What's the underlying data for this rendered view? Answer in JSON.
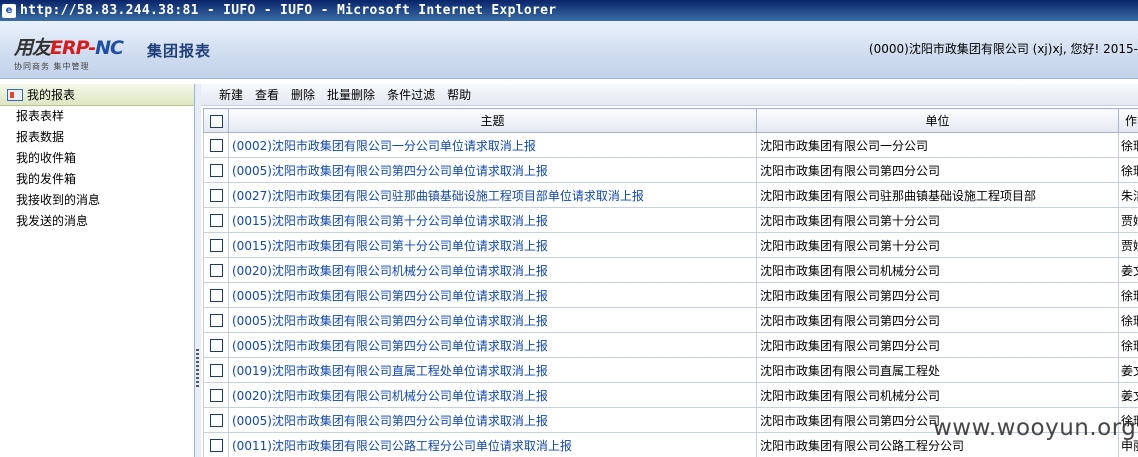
{
  "window": {
    "title": "http://58.83.244.38:81 - IUFO - IUFO - Microsoft Internet Explorer"
  },
  "header": {
    "logo_brand_1": "用友",
    "logo_brand_erp": "ERP-",
    "logo_brand_nc": "NC",
    "logo_sub": "协同商务 集中管理",
    "module_title": "集团报表",
    "user_info": "(0000)沈阳市政集团有限公司  (xj)xj, 您好! 2015-"
  },
  "sidebar": {
    "title": "我的报表",
    "items": [
      {
        "label": "报表表样"
      },
      {
        "label": "报表数据"
      },
      {
        "label": "我的收件箱"
      },
      {
        "label": "我的发件箱"
      },
      {
        "label": "我接收到的消息"
      },
      {
        "label": "我发送的消息"
      }
    ]
  },
  "toolbar": {
    "buttons": [
      {
        "label": "新建"
      },
      {
        "label": "查看"
      },
      {
        "label": "删除"
      },
      {
        "label": "批量删除"
      },
      {
        "label": "条件过滤"
      },
      {
        "label": "帮助"
      }
    ]
  },
  "table": {
    "columns": [
      "主题",
      "单位",
      "作"
    ],
    "rows": [
      {
        "subject": "(0002)沈阳市政集团有限公司一分公司单位请求取消上报",
        "unit": "沈阳市政集团有限公司一分公司",
        "author": "徐瑕"
      },
      {
        "subject": "(0005)沈阳市政集团有限公司第四分公司单位请求取消上报",
        "unit": "沈阳市政集团有限公司第四分公司",
        "author": "徐瑕"
      },
      {
        "subject": "(0027)沈阳市政集团有限公司驻那曲镇基础设施工程项目部单位请求取消上报",
        "unit": "沈阳市政集团有限公司驻那曲镇基础设施工程项目部",
        "author": "朱洁"
      },
      {
        "subject": "(0015)沈阳市政集团有限公司第十分公司单位请求取消上报",
        "unit": "沈阳市政集团有限公司第十分公司",
        "author": "贾姣"
      },
      {
        "subject": "(0015)沈阳市政集团有限公司第十分公司单位请求取消上报",
        "unit": "沈阳市政集团有限公司第十分公司",
        "author": "贾姣"
      },
      {
        "subject": "(0020)沈阳市政集团有限公司机械分公司单位请求取消上报",
        "unit": "沈阳市政集团有限公司机械分公司",
        "author": "姜文"
      },
      {
        "subject": "(0005)沈阳市政集团有限公司第四分公司单位请求取消上报",
        "unit": "沈阳市政集团有限公司第四分公司",
        "author": "徐瑕"
      },
      {
        "subject": "(0005)沈阳市政集团有限公司第四分公司单位请求取消上报",
        "unit": "沈阳市政集团有限公司第四分公司",
        "author": "徐瑕"
      },
      {
        "subject": "(0005)沈阳市政集团有限公司第四分公司单位请求取消上报",
        "unit": "沈阳市政集团有限公司第四分公司",
        "author": "徐瑕"
      },
      {
        "subject": "(0019)沈阳市政集团有限公司直属工程处单位请求取消上报",
        "unit": "沈阳市政集团有限公司直属工程处",
        "author": "姜文"
      },
      {
        "subject": "(0020)沈阳市政集团有限公司机械分公司单位请求取消上报",
        "unit": "沈阳市政集团有限公司机械分公司",
        "author": "姜文"
      },
      {
        "subject": "(0005)沈阳市政集团有限公司第四分公司单位请求取消上报",
        "unit": "沈阳市政集团有限公司第四分公司",
        "author": "徐瑕"
      },
      {
        "subject": "(0011)沈阳市政集团有限公司公路工程分公司单位请求取消上报",
        "unit": "沈阳市政集团有限公司公路工程分公司",
        "author": "申丽"
      }
    ]
  },
  "watermark": "www.wooyun.org"
}
